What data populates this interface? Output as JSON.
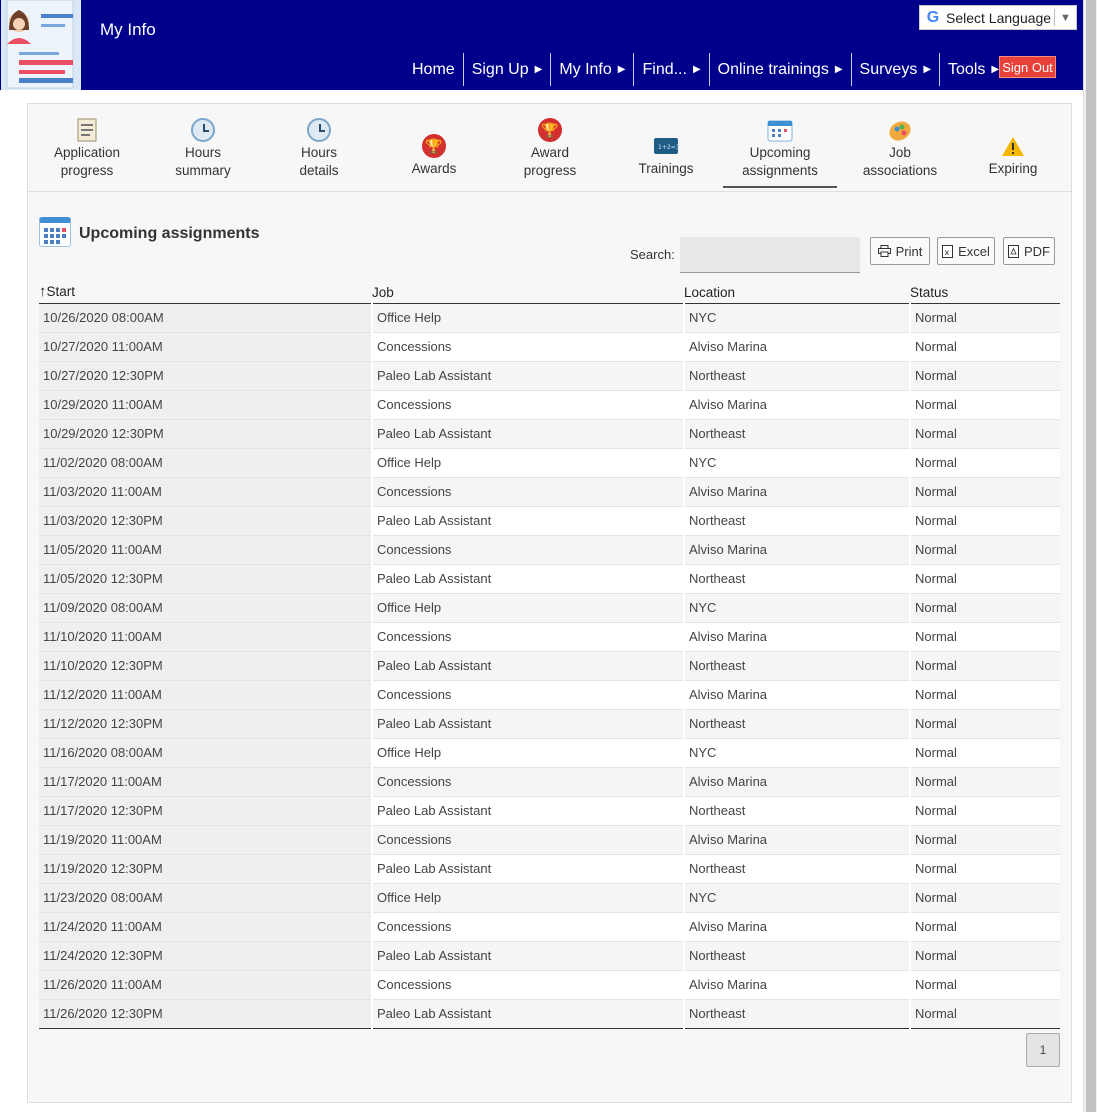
{
  "header": {
    "title": "My Info",
    "language_label": "Select Language",
    "nav": [
      {
        "label": "Home",
        "has_caret": false
      },
      {
        "label": "Sign Up",
        "has_caret": true
      },
      {
        "label": "My Info",
        "has_caret": true
      },
      {
        "label": "Find...",
        "has_caret": true
      },
      {
        "label": "Online trainings",
        "has_caret": true
      },
      {
        "label": "Surveys",
        "has_caret": true
      },
      {
        "label": "Tools",
        "has_caret": true
      }
    ],
    "signout_label": "Sign Out",
    "colors": {
      "header_bg": "#00008b",
      "signout_bg": "#e8413a"
    }
  },
  "tabs": [
    {
      "line1": "Application",
      "line2": "progress",
      "icon": "clipboard-icon"
    },
    {
      "line1": "Hours",
      "line2": "summary",
      "icon": "clock-icon"
    },
    {
      "line1": "Hours",
      "line2": "details",
      "icon": "clock-icon"
    },
    {
      "line1": "Awards",
      "line2": "",
      "icon": "trophy-icon"
    },
    {
      "line1": "Award",
      "line2": "progress",
      "icon": "trophy-icon"
    },
    {
      "line1": "Trainings",
      "line2": "",
      "icon": "chalkboard-icon"
    },
    {
      "line1": "Upcoming",
      "line2": "assignments",
      "icon": "calendar-icon",
      "active": true
    },
    {
      "line1": "Job",
      "line2": "associations",
      "icon": "palette-icon"
    },
    {
      "line1": "Expiring",
      "line2": "",
      "icon": "warning-icon"
    }
  ],
  "section": {
    "title": "Upcoming assignments"
  },
  "search": {
    "label": "Search:",
    "value": ""
  },
  "buttons": {
    "print": "Print",
    "excel": "Excel",
    "pdf": "PDF"
  },
  "table": {
    "columns": [
      "Start",
      "Job",
      "Location",
      "Status"
    ],
    "sort_indicator": "↑",
    "rows": [
      [
        "10/26/2020 08:00AM",
        "Office Help",
        "NYC",
        "Normal"
      ],
      [
        "10/27/2020 11:00AM",
        "Concessions",
        "Alviso Marina",
        "Normal"
      ],
      [
        "10/27/2020 12:30PM",
        "Paleo Lab Assistant",
        "Northeast",
        "Normal"
      ],
      [
        "10/29/2020 11:00AM",
        "Concessions",
        "Alviso Marina",
        "Normal"
      ],
      [
        "10/29/2020 12:30PM",
        "Paleo Lab Assistant",
        "Northeast",
        "Normal"
      ],
      [
        "11/02/2020 08:00AM",
        "Office Help",
        "NYC",
        "Normal"
      ],
      [
        "11/03/2020 11:00AM",
        "Concessions",
        "Alviso Marina",
        "Normal"
      ],
      [
        "11/03/2020 12:30PM",
        "Paleo Lab Assistant",
        "Northeast",
        "Normal"
      ],
      [
        "11/05/2020 11:00AM",
        "Concessions",
        "Alviso Marina",
        "Normal"
      ],
      [
        "11/05/2020 12:30PM",
        "Paleo Lab Assistant",
        "Northeast",
        "Normal"
      ],
      [
        "11/09/2020 08:00AM",
        "Office Help",
        "NYC",
        "Normal"
      ],
      [
        "11/10/2020 11:00AM",
        "Concessions",
        "Alviso Marina",
        "Normal"
      ],
      [
        "11/10/2020 12:30PM",
        "Paleo Lab Assistant",
        "Northeast",
        "Normal"
      ],
      [
        "11/12/2020 11:00AM",
        "Concessions",
        "Alviso Marina",
        "Normal"
      ],
      [
        "11/12/2020 12:30PM",
        "Paleo Lab Assistant",
        "Northeast",
        "Normal"
      ],
      [
        "11/16/2020 08:00AM",
        "Office Help",
        "NYC",
        "Normal"
      ],
      [
        "11/17/2020 11:00AM",
        "Concessions",
        "Alviso Marina",
        "Normal"
      ],
      [
        "11/17/2020 12:30PM",
        "Paleo Lab Assistant",
        "Northeast",
        "Normal"
      ],
      [
        "11/19/2020 11:00AM",
        "Concessions",
        "Alviso Marina",
        "Normal"
      ],
      [
        "11/19/2020 12:30PM",
        "Paleo Lab Assistant",
        "Northeast",
        "Normal"
      ],
      [
        "11/23/2020 08:00AM",
        "Office Help",
        "NYC",
        "Normal"
      ],
      [
        "11/24/2020 11:00AM",
        "Concessions",
        "Alviso Marina",
        "Normal"
      ],
      [
        "11/24/2020 12:30PM",
        "Paleo Lab Assistant",
        "Northeast",
        "Normal"
      ],
      [
        "11/26/2020 11:00AM",
        "Concessions",
        "Alviso Marina",
        "Normal"
      ],
      [
        "11/26/2020 12:30PM",
        "Paleo Lab Assistant",
        "Northeast",
        "Normal"
      ]
    ]
  },
  "pagination": {
    "current_page": "1"
  }
}
